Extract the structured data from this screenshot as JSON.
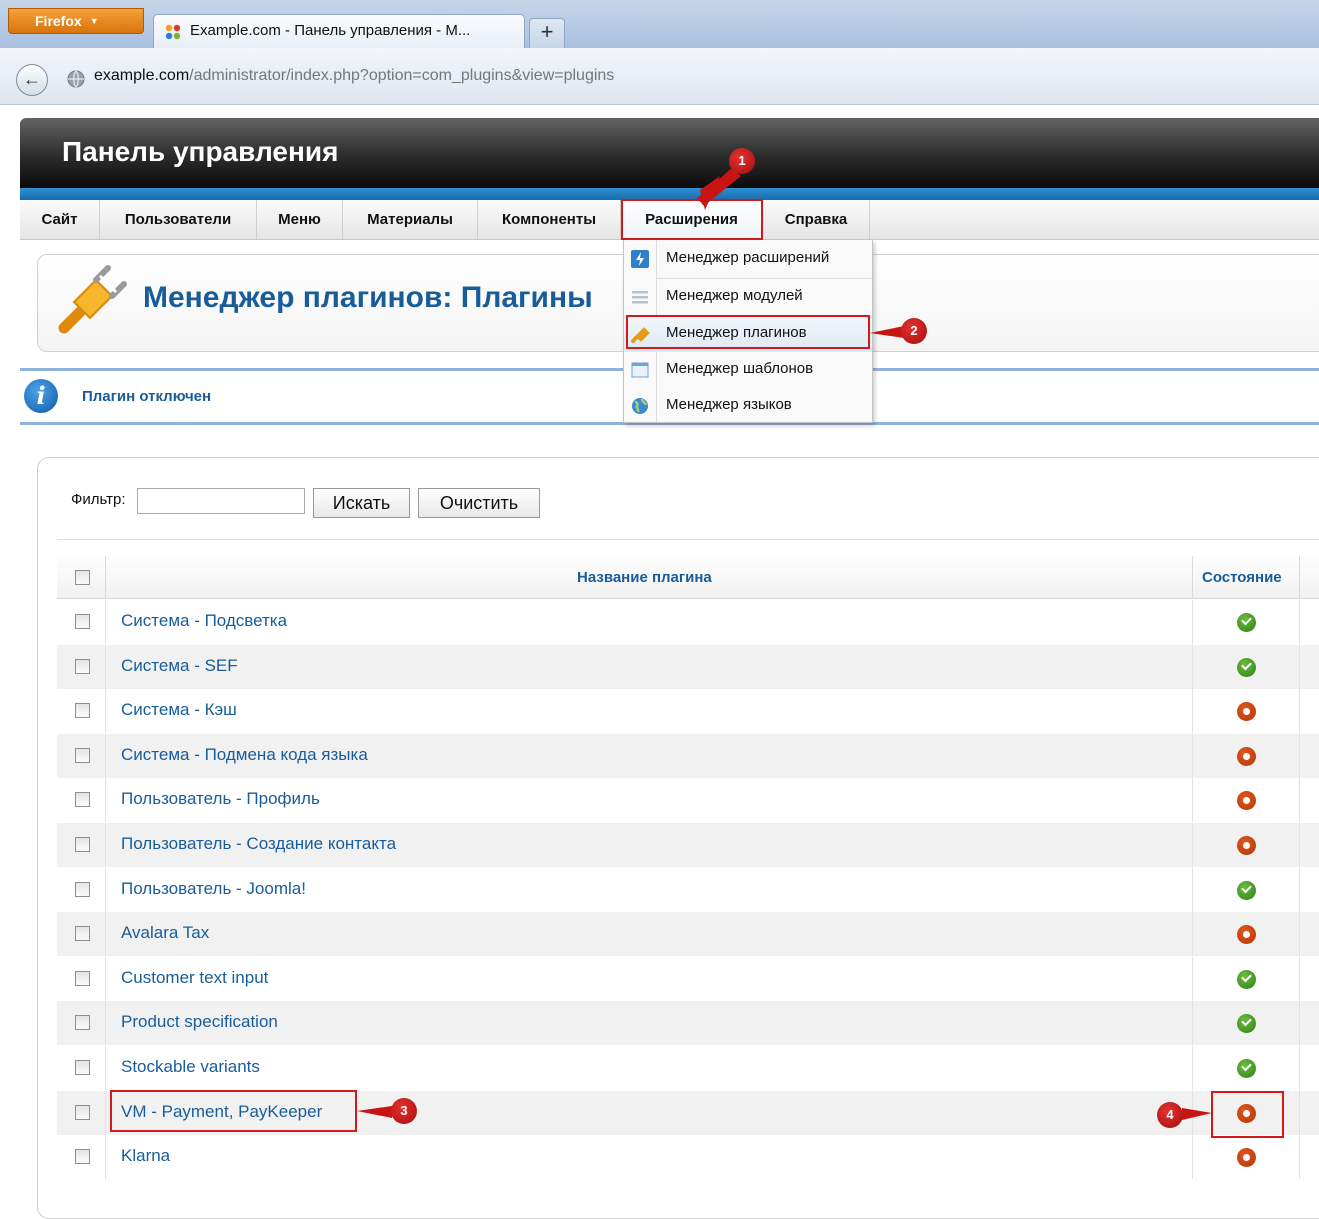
{
  "browser": {
    "menu_button": "Firefox",
    "tab_title": "Example.com - Панель управления - M...",
    "new_tab": "+",
    "back": "←",
    "url_host": "example.com",
    "url_path": "/administrator/index.php?option=com_plugins&view=plugins"
  },
  "admin": {
    "title": "Панель управления",
    "menu": [
      "Сайт",
      "Пользователи",
      "Меню",
      "Материалы",
      "Компоненты",
      "Расширения",
      "Справка"
    ],
    "dropdown": [
      {
        "label": "Менеджер расширений",
        "icon": "install-icon"
      },
      {
        "label": "Менеджер модулей",
        "icon": "module-icon"
      },
      {
        "label": "Менеджер плагинов",
        "icon": "plugin-icon"
      },
      {
        "label": "Менеджер шаблонов",
        "icon": "template-icon"
      },
      {
        "label": "Менеджер языков",
        "icon": "globe-icon"
      }
    ]
  },
  "page": {
    "title": "Менеджер плагинов: Плагины",
    "message": "Плагин отключен",
    "info_glyph": "i"
  },
  "filter": {
    "label": "Фильтр:",
    "value": "",
    "search_button": "Искать",
    "clear_button": "Очистить"
  },
  "table": {
    "col_name": "Название плагина",
    "col_state": "Состояние",
    "rows": [
      {
        "name": "Система - Подсветка",
        "enabled": true
      },
      {
        "name": "Система - SEF",
        "enabled": true
      },
      {
        "name": "Система - Кэш",
        "enabled": false
      },
      {
        "name": "Система - Подмена кода языка",
        "enabled": false
      },
      {
        "name": "Пользователь - Профиль",
        "enabled": false
      },
      {
        "name": "Пользователь - Создание контакта",
        "enabled": false
      },
      {
        "name": "Пользователь - Joomla!",
        "enabled": true
      },
      {
        "name": "Avalara Tax",
        "enabled": false
      },
      {
        "name": "Customer text input",
        "enabled": true
      },
      {
        "name": "Product specification",
        "enabled": true
      },
      {
        "name": "Stockable variants",
        "enabled": true
      },
      {
        "name": "VM - Payment, PayKeeper",
        "enabled": false
      },
      {
        "name": "Klarna",
        "enabled": false
      }
    ]
  },
  "annotations": [
    "1",
    "2",
    "3",
    "4"
  ],
  "colors": {
    "link_blue": "#185d9a",
    "annotation_red": "#d31a1a",
    "enabled_green": "#3a9a1e",
    "disabled_orange": "#cf4a10"
  }
}
